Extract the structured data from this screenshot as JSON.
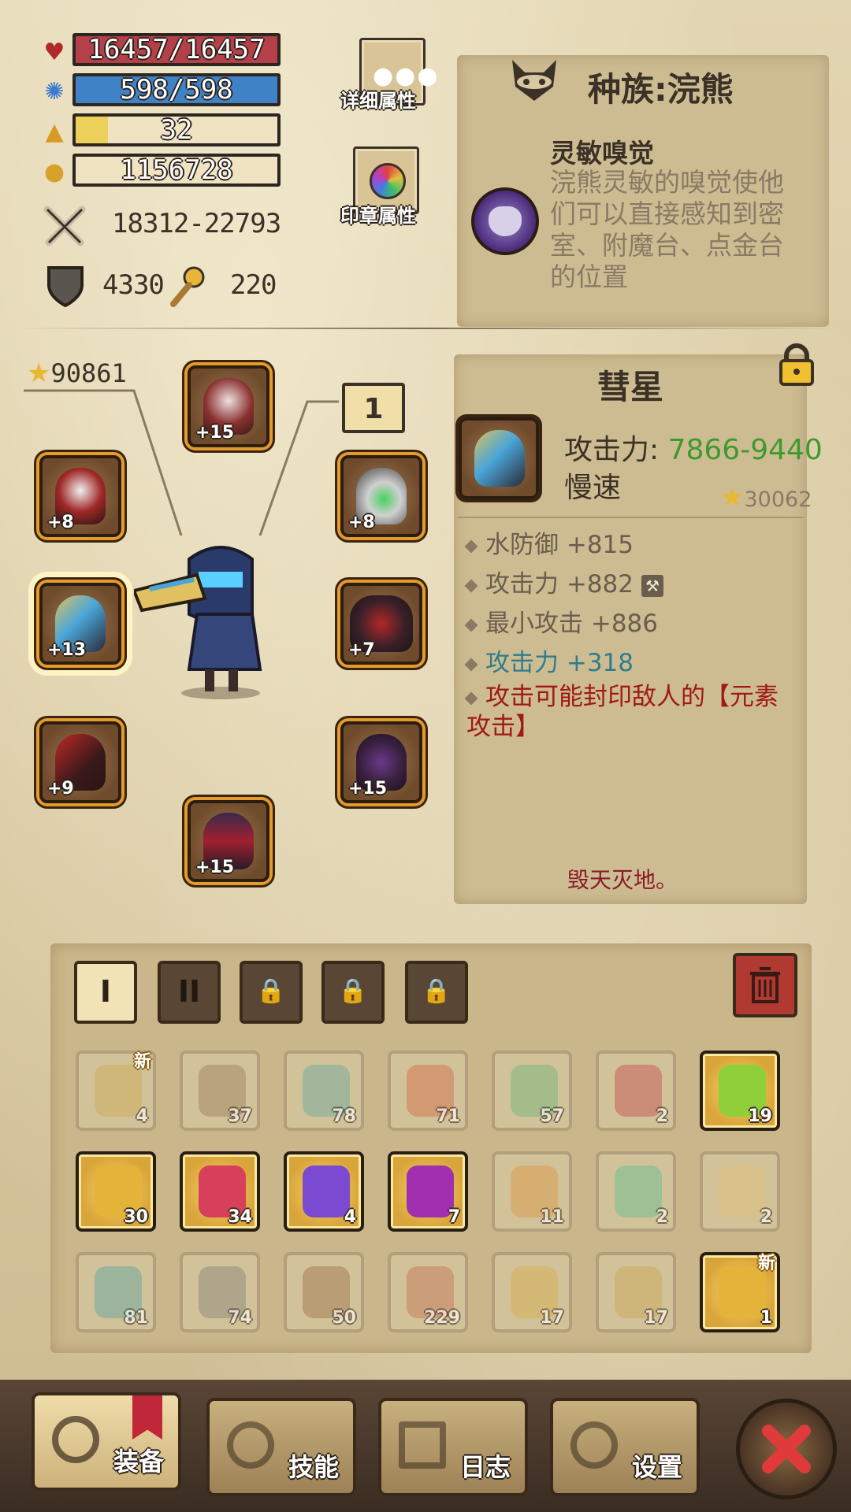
{
  "stats": {
    "hp": "16457/16457",
    "mp": "598/598",
    "level": "32",
    "gold": "1156728",
    "level_progress": 0.16,
    "attack_range": "18312-22793",
    "armor": "4330",
    "resist": "220"
  },
  "buttons": {
    "detail_attrs": "详细属性",
    "seal_attrs": "印章属性"
  },
  "race": {
    "title": "种族:浣熊",
    "skill_name": "灵敏嗅觉",
    "skill_desc": "浣熊灵敏的嗅觉使他们可以直接感知到密室、附魔台、点金台的位置"
  },
  "equip": {
    "score": "90861",
    "page_badge": "1",
    "slots": [
      {
        "name": "helmet",
        "level": "+15"
      },
      {
        "name": "shoulder",
        "level": "+8"
      },
      {
        "name": "amulet",
        "level": "+8"
      },
      {
        "name": "weapon",
        "level": "+13"
      },
      {
        "name": "wings",
        "level": "+7"
      },
      {
        "name": "bracer",
        "level": "+9"
      },
      {
        "name": "belt",
        "level": "+15"
      },
      {
        "name": "boots",
        "level": "+15"
      }
    ]
  },
  "item_detail": {
    "name": "彗星",
    "attack_label": "攻击力:",
    "attack_value": "7866-9440",
    "speed": "慢速",
    "score": "30062",
    "affixes": [
      {
        "text": "水防御 +815",
        "color": "#6b5d4d"
      },
      {
        "text": "攻击力 +882",
        "color": "#6b5d4d"
      },
      {
        "text": "最小攻击 +886",
        "color": "#6b5d4d"
      },
      {
        "text": "攻击力 +318",
        "color": "#2f7d8c"
      },
      {
        "text": "攻击可能封印敌人的【元素攻击】",
        "color": "#a01818"
      }
    ],
    "flavor": "毁天灭地。"
  },
  "bag": {
    "tabs": [
      "I",
      "II",
      "🔒",
      "🔒",
      "🔒"
    ],
    "items": [
      {
        "count": "4",
        "state": "off",
        "new": "新",
        "color": "#c9a23c"
      },
      {
        "count": "37",
        "state": "off",
        "new": "",
        "color": "#8a6a48"
      },
      {
        "count": "78",
        "state": "off",
        "new": "",
        "color": "#4aa0a0"
      },
      {
        "count": "71",
        "state": "off",
        "new": "",
        "color": "#d0502a"
      },
      {
        "count": "57",
        "state": "off",
        "new": "",
        "color": "#4fae6e"
      },
      {
        "count": "2",
        "state": "off",
        "new": "",
        "color": "#c0283a"
      },
      {
        "count": "19",
        "state": "on",
        "new": "",
        "color": "#8fcf3a"
      },
      {
        "count": "30",
        "state": "on",
        "new": "",
        "color": "#e4b43a"
      },
      {
        "count": "34",
        "state": "on",
        "new": "",
        "color": "#d6405a"
      },
      {
        "count": "4",
        "state": "on",
        "new": "",
        "color": "#7a4ad0"
      },
      {
        "count": "7",
        "state": "on",
        "new": "",
        "color": "#a030b0"
      },
      {
        "count": "11",
        "state": "off",
        "new": "",
        "color": "#e08a28"
      },
      {
        "count": "2",
        "state": "off",
        "new": "",
        "color": "#3cc08a"
      },
      {
        "count": "2",
        "state": "off",
        "new": "",
        "color": "#e6c070"
      },
      {
        "count": "81",
        "state": "off",
        "new": "",
        "color": "#3a9aa0"
      },
      {
        "count": "74",
        "state": "off",
        "new": "",
        "color": "#707070"
      },
      {
        "count": "50",
        "state": "off",
        "new": "",
        "color": "#8a5a30"
      },
      {
        "count": "229",
        "state": "off",
        "new": "",
        "color": "#c05a3a"
      },
      {
        "count": "17",
        "state": "off",
        "new": "",
        "color": "#d8a830"
      },
      {
        "count": "17",
        "state": "off",
        "new": "",
        "color": "#c8a040"
      },
      {
        "count": "1",
        "state": "on",
        "new": "新",
        "color": "#e4b43a"
      }
    ]
  },
  "nav": {
    "equip": "装备",
    "skills": "技能",
    "log": "日志",
    "settings": "设置"
  }
}
